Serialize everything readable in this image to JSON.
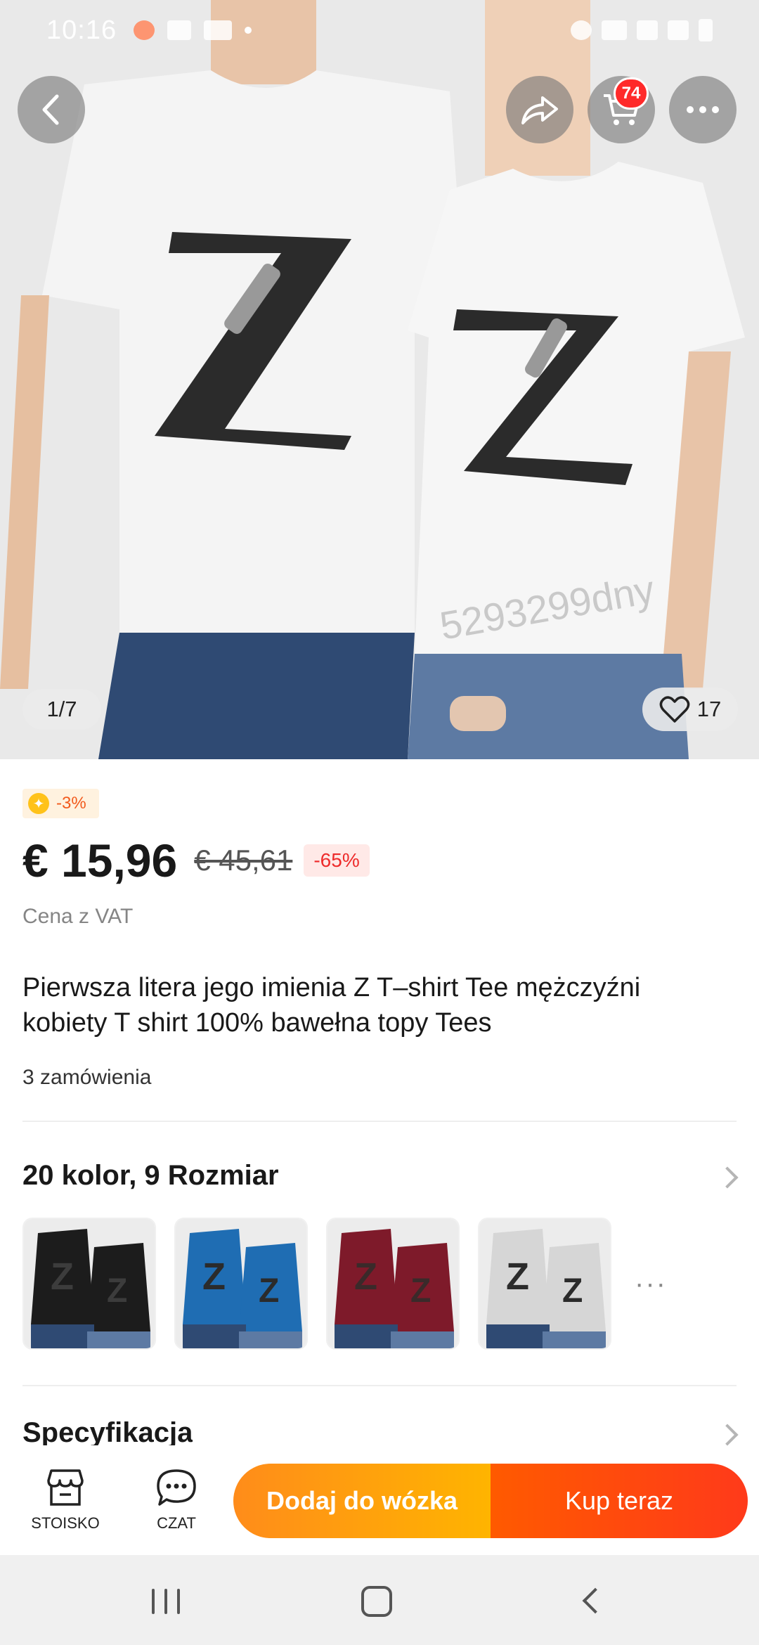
{
  "status_bar": {
    "time": "10:16"
  },
  "hero": {
    "cart_count": "74",
    "pager": "1/7",
    "likes": "17",
    "watermark": "5293299dny"
  },
  "product": {
    "coin_discount": "-3%",
    "price": "€ 15,96",
    "old_price": "€ 45,61",
    "discount": "-65%",
    "vat_note": "Cena z VAT",
    "title": "Pierwsza litera jego imienia Z T–shirt Tee mężczyźni kobiety T shirt 100% bawełna topy Tees",
    "orders": "3 zamówienia"
  },
  "variants": {
    "title": "20 kolor, 9 Rozmiar",
    "thumbnail_colors": [
      "#1c1c1c",
      "#1f6db3",
      "#7e1a2a",
      "#d6d6d6"
    ],
    "more": "···"
  },
  "spec": {
    "title": "Specyfikacja"
  },
  "bottom_bar": {
    "store_label": "STOISKO",
    "chat_label": "CZAT",
    "add_to_cart": "Dodaj do wózka",
    "buy_now": "Kup teraz"
  }
}
